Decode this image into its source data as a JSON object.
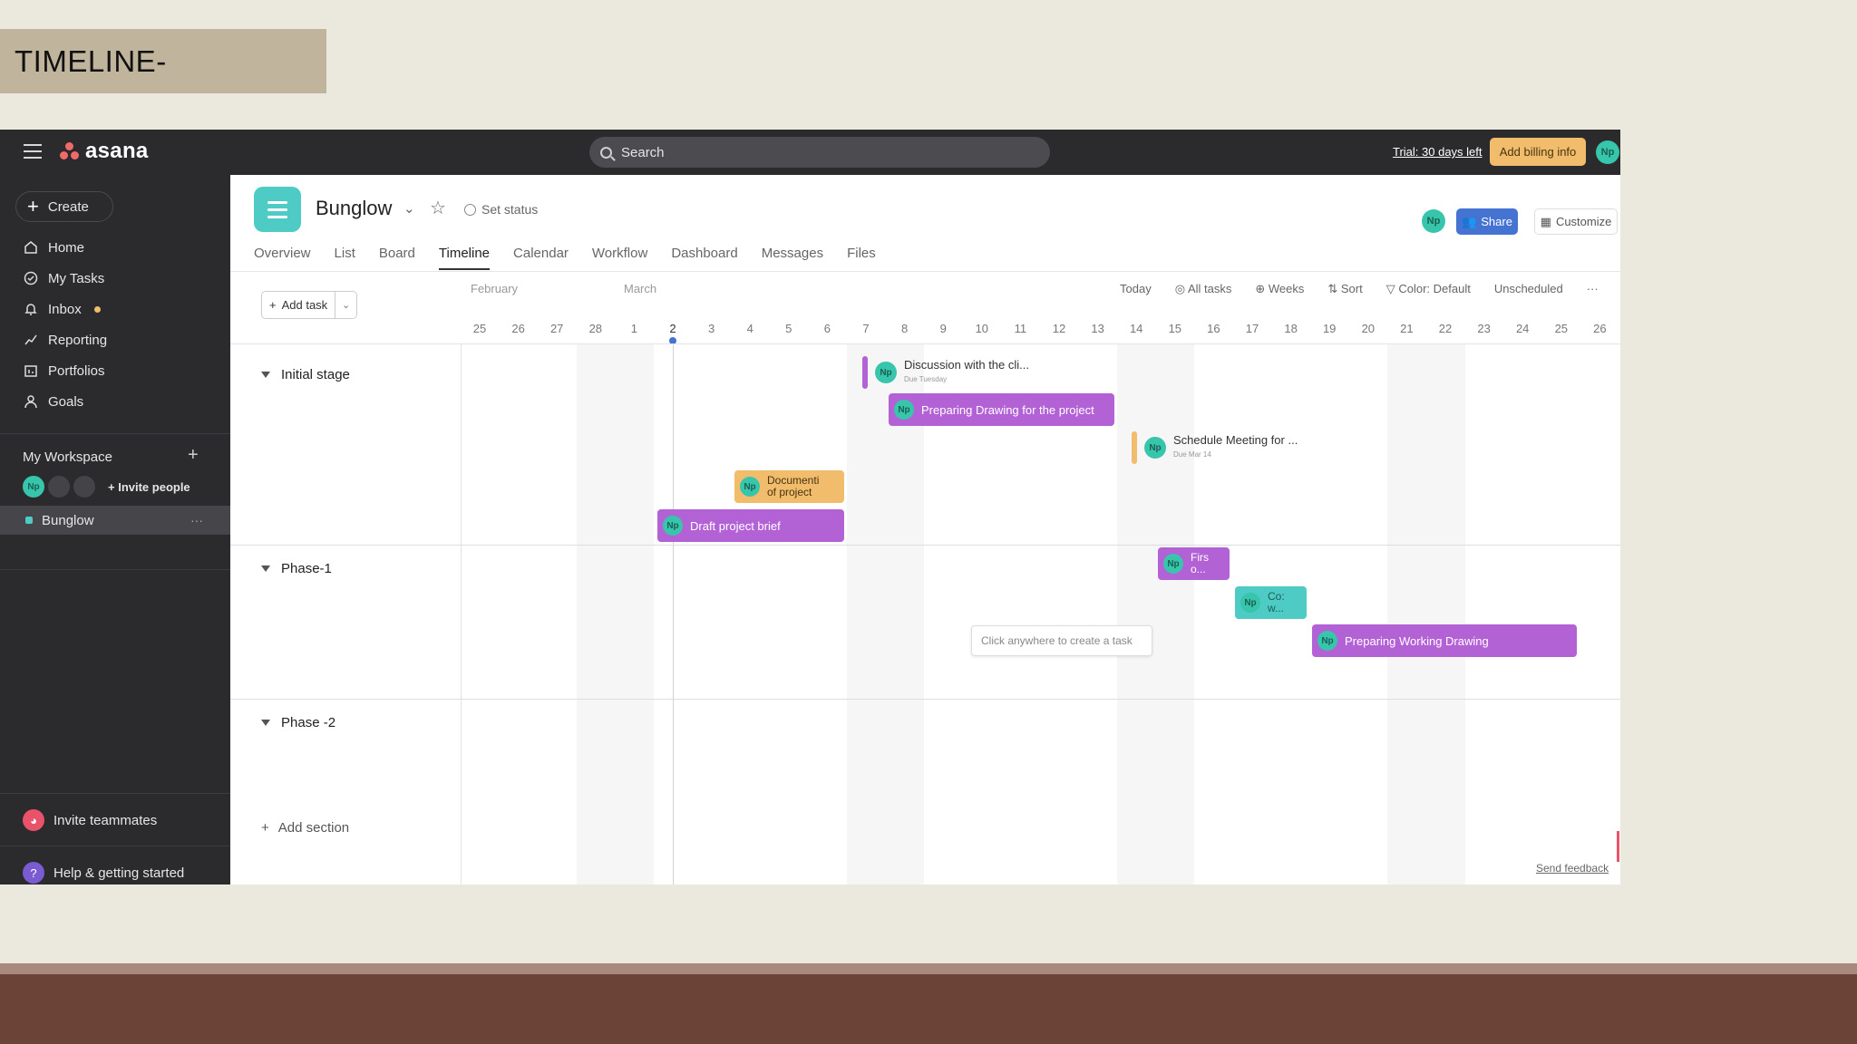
{
  "slide": {
    "title": "TIMELINE-"
  },
  "topbar": {
    "logo": "asana",
    "search_placeholder": "Search",
    "trial": "Trial: 30 days left",
    "billing": "Add billing info",
    "avatar": "Np"
  },
  "sidebar": {
    "create": "Create",
    "nav": [
      {
        "label": "Home",
        "icon": "home-icon"
      },
      {
        "label": "My Tasks",
        "icon": "check-circle-icon"
      },
      {
        "label": "Inbox",
        "icon": "bell-icon"
      },
      {
        "label": "Reporting",
        "icon": "chart-line-icon"
      },
      {
        "label": "Portfolios",
        "icon": "portfolio-icon"
      },
      {
        "label": "Goals",
        "icon": "person-icon"
      }
    ],
    "workspace_title": "My Workspace",
    "avatar": "Np",
    "invite_people": "+ Invite people",
    "project": "Bunglow",
    "invite_teammates": "Invite teammates",
    "help": "Help & getting started"
  },
  "header": {
    "project_title": "Bunglow",
    "set_status": "Set status",
    "avatar": "Np",
    "share": "Share",
    "customize": "Customize",
    "tabs": [
      "Overview",
      "List",
      "Board",
      "Timeline",
      "Calendar",
      "Workflow",
      "Dashboard",
      "Messages",
      "Files"
    ],
    "active_tab": "Timeline"
  },
  "toolbar": {
    "add_task": "Add task",
    "months": [
      "February",
      "March"
    ],
    "items": [
      "Today",
      "All tasks",
      "Weeks",
      "Sort",
      "Color: Default",
      "Unscheduled",
      "···"
    ]
  },
  "dates": [
    "25",
    "26",
    "27",
    "28",
    "1",
    "2",
    "3",
    "4",
    "5",
    "6",
    "7",
    "8",
    "9",
    "10",
    "11",
    "12",
    "13",
    "14",
    "15",
    "16",
    "17",
    "18",
    "19",
    "20",
    "21",
    "22",
    "23",
    "24",
    "25",
    "26"
  ],
  "today_index": 5,
  "sections": [
    "Initial stage",
    "Phase-1",
    "Phase -2"
  ],
  "add_section": "Add section",
  "tasks": {
    "discussion": {
      "title": "Discussion with the cli...",
      "sub": "Due Tuesday",
      "avatar": "Np"
    },
    "preparing_drawing": {
      "title": "Preparing Drawing for the project",
      "avatar": "Np"
    },
    "schedule_meeting": {
      "title": "Schedule Meeting for ...",
      "sub": "Due Mar 14",
      "avatar": "Np"
    },
    "documentation": {
      "line1": "Documenti",
      "line2": "of project",
      "avatar": "Np"
    },
    "draft_brief": {
      "title": "Draft project brief",
      "avatar": "Np"
    },
    "first_task": {
      "line1": "Firs",
      "line2": "o...",
      "avatar": "Np"
    },
    "consult_task": {
      "line1": "Co:",
      "line2": "w...",
      "avatar": "Np"
    },
    "working_drawing": {
      "title": "Preparing Working Drawing",
      "avatar": "Np"
    }
  },
  "hint": "Click anywhere to create a task",
  "feedback": "Send feedback",
  "colors": {
    "purple": "#b362d6",
    "orange": "#f1bd6c",
    "teal": "#4ecbc4",
    "share": "#4573d2",
    "topbar": "#2b2b2e"
  }
}
